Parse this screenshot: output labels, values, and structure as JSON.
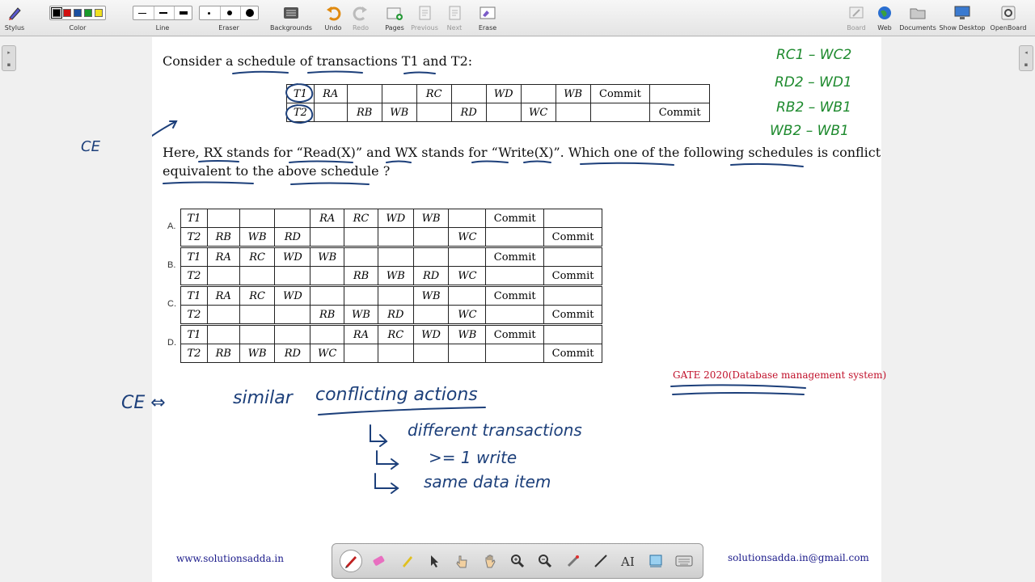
{
  "toolbar": {
    "stylus": "Stylus",
    "color": "Color",
    "line": "Line",
    "eraser": "Eraser",
    "backgrounds": "Backgrounds",
    "undo": "Undo",
    "redo": "Redo",
    "pages": "Pages",
    "previous": "Previous",
    "next": "Next",
    "erase": "Erase",
    "board": "Board",
    "web": "Web",
    "documents": "Documents",
    "show_desktop": "Show Desktop",
    "openboard": "OpenBoard",
    "colors": [
      "#000000",
      "#d01010",
      "#1a4fa0",
      "#1a9a2a",
      "#f0e020"
    ]
  },
  "question": {
    "line1": "Consider a schedule of transactions T1 and T2:",
    "line2": "Here, RX stands for “Read(X)” and WX stands for “Write(X)”. Which one of the following schedules is conflict",
    "line3": "equivalent to the above schedule ?"
  },
  "main_schedule": {
    "t1": "T1",
    "t2": "T2",
    "row1": [
      "RA",
      "",
      "",
      "RC",
      "",
      "WD",
      "",
      "WB",
      "Commit",
      ""
    ],
    "row2": [
      "",
      "RB",
      "WB",
      "",
      "RD",
      "",
      "WC",
      "",
      "",
      "Commit"
    ],
    "ink_subscripts": [
      "1",
      "2",
      "2",
      "1",
      "2",
      "1",
      "2",
      "1"
    ]
  },
  "options": [
    {
      "label": "A.",
      "t1": "T1",
      "t2": "T2",
      "row1": [
        "",
        "",
        "",
        "RA",
        "RC",
        "WD",
        "WB",
        "",
        "Commit",
        ""
      ],
      "row2": [
        "RB",
        "WB",
        "RD",
        "",
        "",
        "",
        "",
        "WC",
        "",
        "Commit"
      ]
    },
    {
      "label": "B.",
      "t1": "T1",
      "t2": "T2",
      "row1": [
        "RA",
        "RC",
        "WD",
        "WB",
        "",
        "",
        "",
        "",
        "Commit",
        ""
      ],
      "row2": [
        "",
        "",
        "",
        "",
        "RB",
        "WB",
        "RD",
        "WC",
        "",
        "Commit"
      ]
    },
    {
      "label": "C.",
      "t1": "T1",
      "t2": "T2",
      "row1": [
        "RA",
        "RC",
        "WD",
        "",
        "",
        "",
        "WB",
        "",
        "Commit",
        ""
      ],
      "row2": [
        "",
        "",
        "",
        "RB",
        "WB",
        "RD",
        "",
        "WC",
        "",
        "Commit"
      ]
    },
    {
      "label": "D.",
      "t1": "T1",
      "t2": "T2",
      "row1": [
        "",
        "",
        "",
        "",
        "RA",
        "RC",
        "WD",
        "WB",
        "Commit",
        ""
      ],
      "row2": [
        "RB",
        "WB",
        "RD",
        "WC",
        "",
        "",
        "",
        "",
        "",
        "Commit"
      ]
    }
  ],
  "annotations": {
    "ce_left": "CE",
    "conflicts": [
      "RC1 – WC2",
      "RD2 – WD1",
      "RB2 – WB1",
      "WB2 – WB1"
    ],
    "ce_arrow": "CE ⇔",
    "similar": "similar",
    "conflicting_actions": "conflicting actions",
    "rule1": "different transactions",
    "rule2": ">= 1 write",
    "rule3": "same data item",
    "gate_ref": "GATE 2020(Database management system)"
  },
  "footer": {
    "website": "www.solutionsadda.in",
    "email": "solutionsadda.in@gmail.com"
  },
  "colors": {
    "ink_blue": "#1c3f7a",
    "ink_green": "#1e8a2e",
    "gate_red": "#c0102a"
  }
}
